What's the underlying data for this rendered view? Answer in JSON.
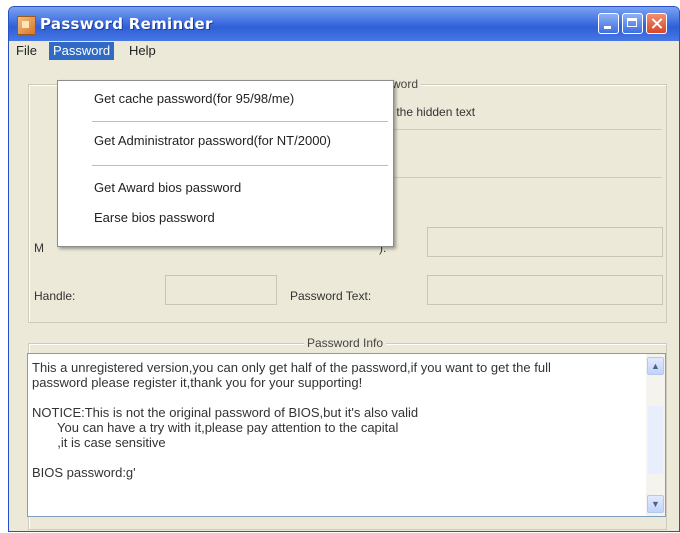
{
  "window": {
    "title": "Password Reminder"
  },
  "menu": {
    "file": "File",
    "password": "Password",
    "help": "Help"
  },
  "dropdown": {
    "items": [
      "Get cache password(for 95/98/me)",
      "Get Administrator password(for NT/2000)",
      "Get Award bios password",
      "Earse bios password"
    ]
  },
  "upper": {
    "legend_partial": "ssword",
    "hint_partial": "eal the hidden text",
    "mouse_label_partial": "M",
    "password_label_partial": "):",
    "handle_label": "Handle:",
    "password_text_label": "Password Text:"
  },
  "info": {
    "legend": "Password Info",
    "lines": [
      "This a unregistered version,you can only get half of the password,if you want to get the full",
      "password please register it,thank you for your supporting!",
      "",
      "NOTICE:This is not the original password of BIOS,but it's also valid",
      "       You can have a try with it,please pay attention to the capital",
      "       ,it is case sensitive",
      "",
      "BIOS password:g'"
    ]
  }
}
